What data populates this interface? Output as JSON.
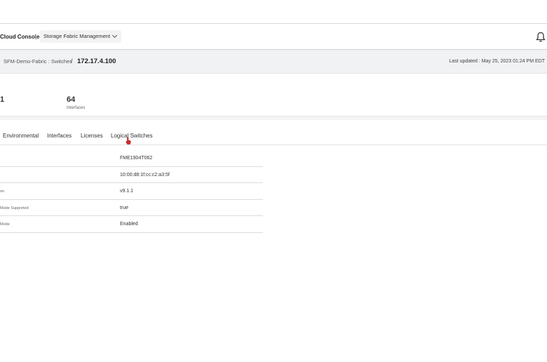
{
  "header": {
    "brand": "Cloud Console",
    "separator": "|",
    "app_selector": "Storage Fabric Management"
  },
  "icons": {
    "bell": "bell-icon",
    "chevron": "chevron-down-icon",
    "cursor": "hand-pointer-icon"
  },
  "breadcrumb": {
    "parent": "SFM-Demo-Fabric : Switches",
    "separator": "/",
    "current": "172.17.4.100",
    "last_updated": "Last updated :  May 25, 2023 01:24 PM EDT"
  },
  "stats": {
    "left_partial": "1",
    "interfaces_value": "64",
    "interfaces_label": "Interfaces"
  },
  "tabs": [
    "Environmental",
    "Interfaces",
    "Licenses",
    "Logical Switches"
  ],
  "details": [
    {
      "key": "",
      "value": "FME1904T062"
    },
    {
      "key": "",
      "value": "10:00:d8:1f:cc:c2:a3:5f"
    },
    {
      "key": "on",
      "value": "v9.1.1"
    },
    {
      "key": "Mode Supported",
      "value": "true"
    },
    {
      "key": "Mode",
      "value": "Enabled"
    }
  ]
}
